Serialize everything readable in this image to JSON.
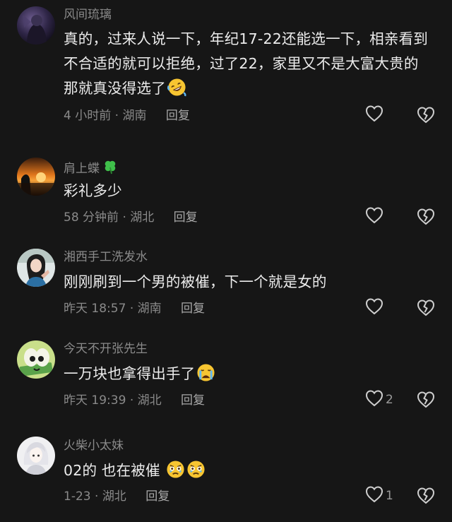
{
  "comments": [
    {
      "username": "风间琉璃",
      "text": "真的，过来人说一下，年纪17-22还能选一下，相亲看到不合适的就可以拒绝，过了22，家里又不是大富大贵的那就真没得选了",
      "time": "4 小时前",
      "location": "湖南",
      "reply_label": "回复",
      "like_count": "",
      "emoji": "rofl-emoji"
    },
    {
      "username": "肩上蝶",
      "text": "彩礼多少",
      "time": "58 分钟前",
      "location": "湖北",
      "reply_label": "回复",
      "like_count": "",
      "badge_icon": "four-leaf-clover-icon"
    },
    {
      "username": "湘西手工洗发水",
      "text": "刚刚刷到一个男的被催，下一个就是女的",
      "time": "昨天 18:57",
      "location": "湖南",
      "reply_label": "回复",
      "like_count": ""
    },
    {
      "username": "今天不开张先生",
      "text": "一万块也拿得出手了",
      "time": "昨天 19:39",
      "location": "湖北",
      "reply_label": "回复",
      "like_count": "2",
      "emoji": "crying-emoji"
    },
    {
      "username": "火柴小太妹",
      "text": "02的 也在被催",
      "time": "1-23",
      "location": "湖北",
      "reply_label": "回复",
      "like_count": "1",
      "emoji": "holding-back-tears-emoji"
    }
  ],
  "meta_separator": "·",
  "colors": {
    "background": "#161616",
    "username": "#8a8a8a",
    "text": "#ececec",
    "meta": "#8a8a8a"
  }
}
